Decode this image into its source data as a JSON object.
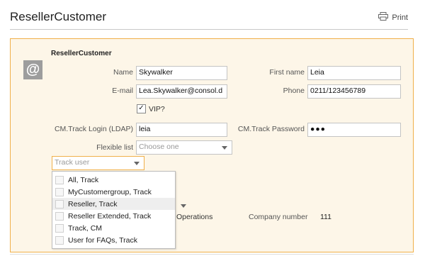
{
  "page": {
    "title": "ResellerCustomer",
    "print_label": "Print"
  },
  "card": {
    "heading": "ResellerCustomer",
    "avatar_glyph": "@",
    "name": {
      "label": "Name",
      "value": "Skywalker"
    },
    "first_name": {
      "label": "First name",
      "value": "Leia"
    },
    "email": {
      "label": "E-mail",
      "value": "Lea.Skywalker@consol.d"
    },
    "phone": {
      "label": "Phone",
      "value": "0211/123456789"
    },
    "vip": {
      "label": "VIP?",
      "checked": true,
      "check_glyph": "✓"
    },
    "login": {
      "label": "CM.Track Login (LDAP)",
      "value": "leia"
    },
    "password": {
      "label": "CM.Track Password",
      "value": "●●●"
    },
    "flexible_list": {
      "label": "Flexible list",
      "placeholder": "Choose one"
    },
    "track_user": {
      "placeholder": "Track user"
    },
    "track_user_options": [
      "All, Track",
      "MyCustomergroup, Track",
      "Reseller, Track",
      "Reseller Extended, Track",
      "Track, CM",
      "User for FAQs, Track"
    ],
    "hovered_option_index": 2,
    "operations_text": "Operations",
    "company_number": {
      "label": "Company number",
      "value": "111"
    }
  },
  "colors": {
    "accent_border": "#f0b04a",
    "card_bg": "#fdf6e8",
    "avatar_bg": "#9d9d9d"
  },
  "icons": {
    "print": "printer-icon",
    "avatar": "at-sign-icon"
  }
}
